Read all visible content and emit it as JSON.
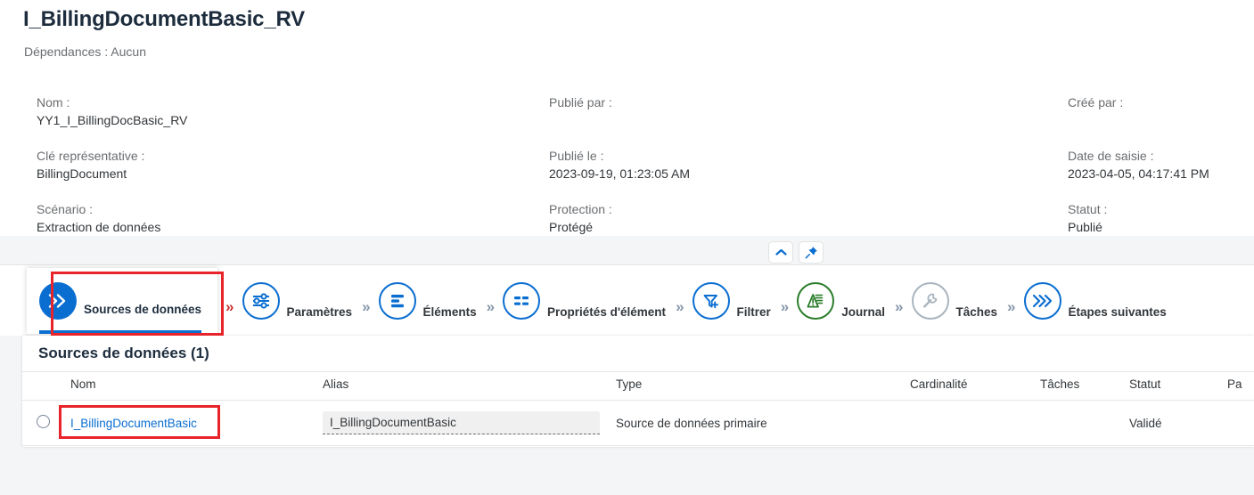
{
  "header": {
    "title": "I_BillingDocumentBasic_RV",
    "subtitle": "Dépendances : Aucun",
    "actions": {
      "collapse": "collapse-header",
      "pin": "pin-header"
    },
    "columns": [
      {
        "fields": [
          {
            "label": "Nom :",
            "value": "YY1_I_BillingDocBasic_RV"
          },
          {
            "label": "Clé représentative :",
            "value": "BillingDocument"
          },
          {
            "label": "Scénario :",
            "value": "Extraction de données"
          }
        ]
      },
      {
        "fields": [
          {
            "label": "Publié par :",
            "value": ""
          },
          {
            "label": "Publié le :",
            "value": "2023-09-19, 01:23:05 AM"
          },
          {
            "label": "Protection :",
            "value": "Protégé"
          }
        ]
      },
      {
        "fields": [
          {
            "label": "Créé par :",
            "value": ""
          },
          {
            "label": "Date de saisie :",
            "value": "2023-04-05, 04:17:41 PM"
          },
          {
            "label": "Statut :",
            "value": "Publié"
          }
        ]
      }
    ]
  },
  "wizard": {
    "steps": [
      {
        "label": "Sources de données",
        "icon": "double-chevron-right-icon",
        "state": "active"
      },
      {
        "label": "Paramètres",
        "icon": "sliders-icon",
        "state": "blue"
      },
      {
        "label": "Éléments",
        "icon": "list-bars-icon",
        "state": "blue"
      },
      {
        "label": "Propriétés d'élément",
        "icon": "table-rows-icon",
        "state": "blue"
      },
      {
        "label": "Filtrer",
        "icon": "filter-add-icon",
        "state": "blue"
      },
      {
        "label": "Journal",
        "icon": "log-warning-icon",
        "state": "green"
      },
      {
        "label": "Tâches",
        "icon": "wrench-icon",
        "state": "gray"
      },
      {
        "label": "Étapes suivantes",
        "icon": "triple-chevron-right-icon",
        "state": "blue"
      }
    ],
    "separator": "»"
  },
  "table": {
    "title": "Sources de données (1)",
    "headers": [
      "",
      "Nom",
      "Alias",
      "Type",
      "Cardinalité",
      "Tâches",
      "Statut",
      "Pa"
    ],
    "rows": [
      {
        "name": "I_BillingDocumentBasic",
        "alias": "I_BillingDocumentBasic",
        "type": "Source de données primaire",
        "cardinality": "",
        "tasks": "",
        "status": "Validé",
        "parameters": ""
      }
    ]
  },
  "colors": {
    "accent": "#0a6ed1",
    "green": "#2b7d2b",
    "gray": "#a9b4be",
    "annotation": "#e8232a",
    "text": "#32363a",
    "label": "#6a6d70"
  }
}
